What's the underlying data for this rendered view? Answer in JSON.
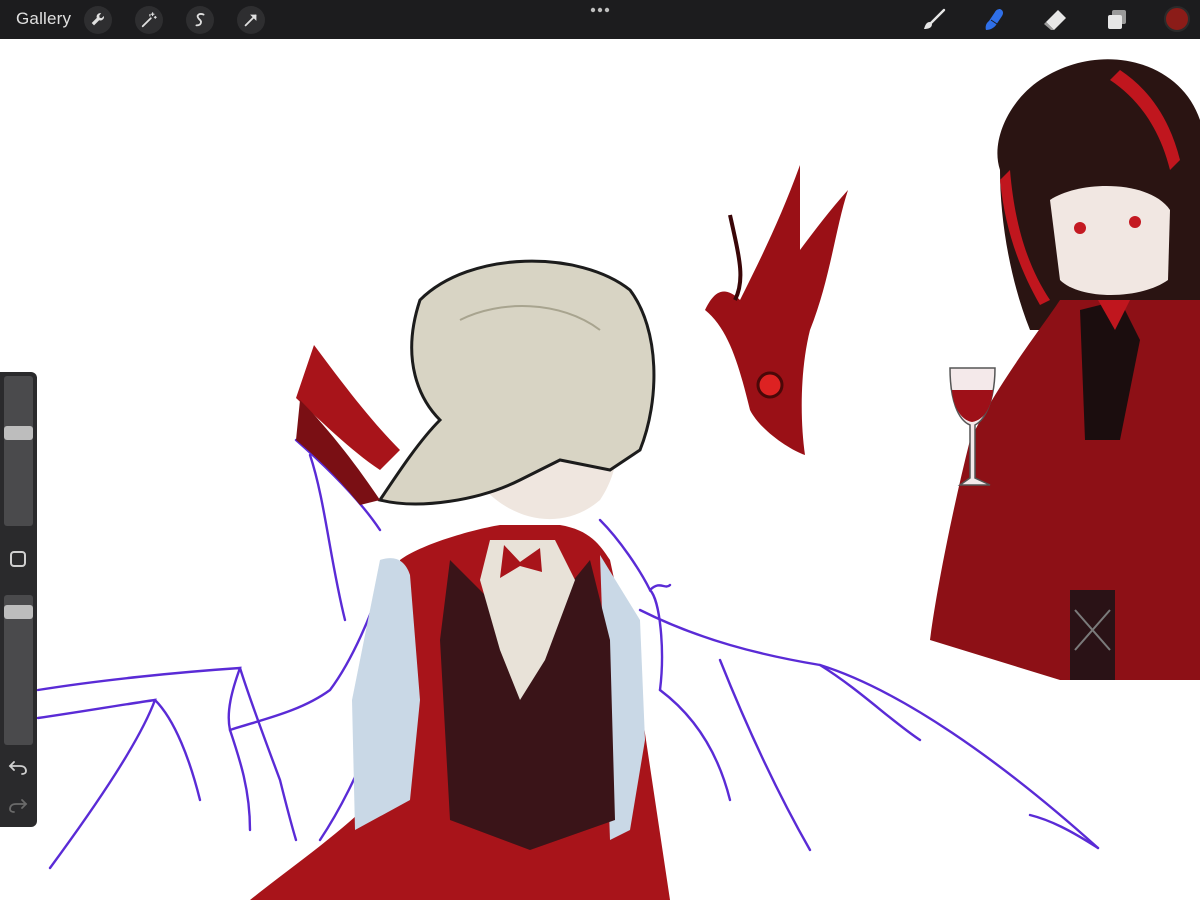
{
  "toolbar": {
    "gallery_label": "Gallery",
    "left_tools": [
      {
        "name": "actions",
        "icon": "wrench-icon"
      },
      {
        "name": "adjustments",
        "icon": "magic-wand-icon"
      },
      {
        "name": "selection",
        "icon": "selection-s-icon"
      },
      {
        "name": "transform",
        "icon": "transform-arrow-icon"
      }
    ],
    "right_tools": [
      {
        "name": "brush",
        "icon": "brush-icon",
        "active": false
      },
      {
        "name": "smudge",
        "icon": "smudge-finger-icon",
        "active": true
      },
      {
        "name": "eraser",
        "icon": "eraser-icon",
        "active": false
      },
      {
        "name": "layers",
        "icon": "layers-icon",
        "active": false
      }
    ],
    "more_icon": "ellipsis-icon",
    "current_color": "#8b1c18",
    "active_tool_color": "#2f6fe8"
  },
  "sidebar": {
    "brush_size_level": 0.63,
    "opacity_level": 0.93,
    "modify_icon": "square-modify-icon",
    "undo_icon": "undo-icon",
    "redo_icon": "redo-icon"
  },
  "canvas": {
    "background": "#ffffff",
    "sketch_stroke_color": "#5a2bd6",
    "primary_red": "#a8141a",
    "hair_light": "#d8d4c4",
    "hair_dark_ref": "#2a1412"
  }
}
